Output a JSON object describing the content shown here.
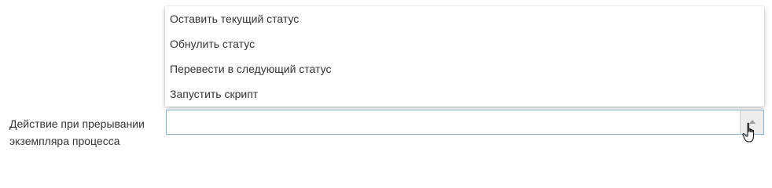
{
  "form": {
    "field_label": "Действие при прерывании экземпляра процесса",
    "select_value": "",
    "options": [
      "Оставить текущий статус",
      "Обнулить статус",
      "Перевести в следующий статус",
      "Запустить скрипт"
    ]
  },
  "icons": {
    "toggle": "chevron-up-icon",
    "cursor": "hand-pointer-icon"
  },
  "colors": {
    "select_border": "#8fb3cf",
    "toggle_bg": "#ececec",
    "text": "#333333"
  }
}
